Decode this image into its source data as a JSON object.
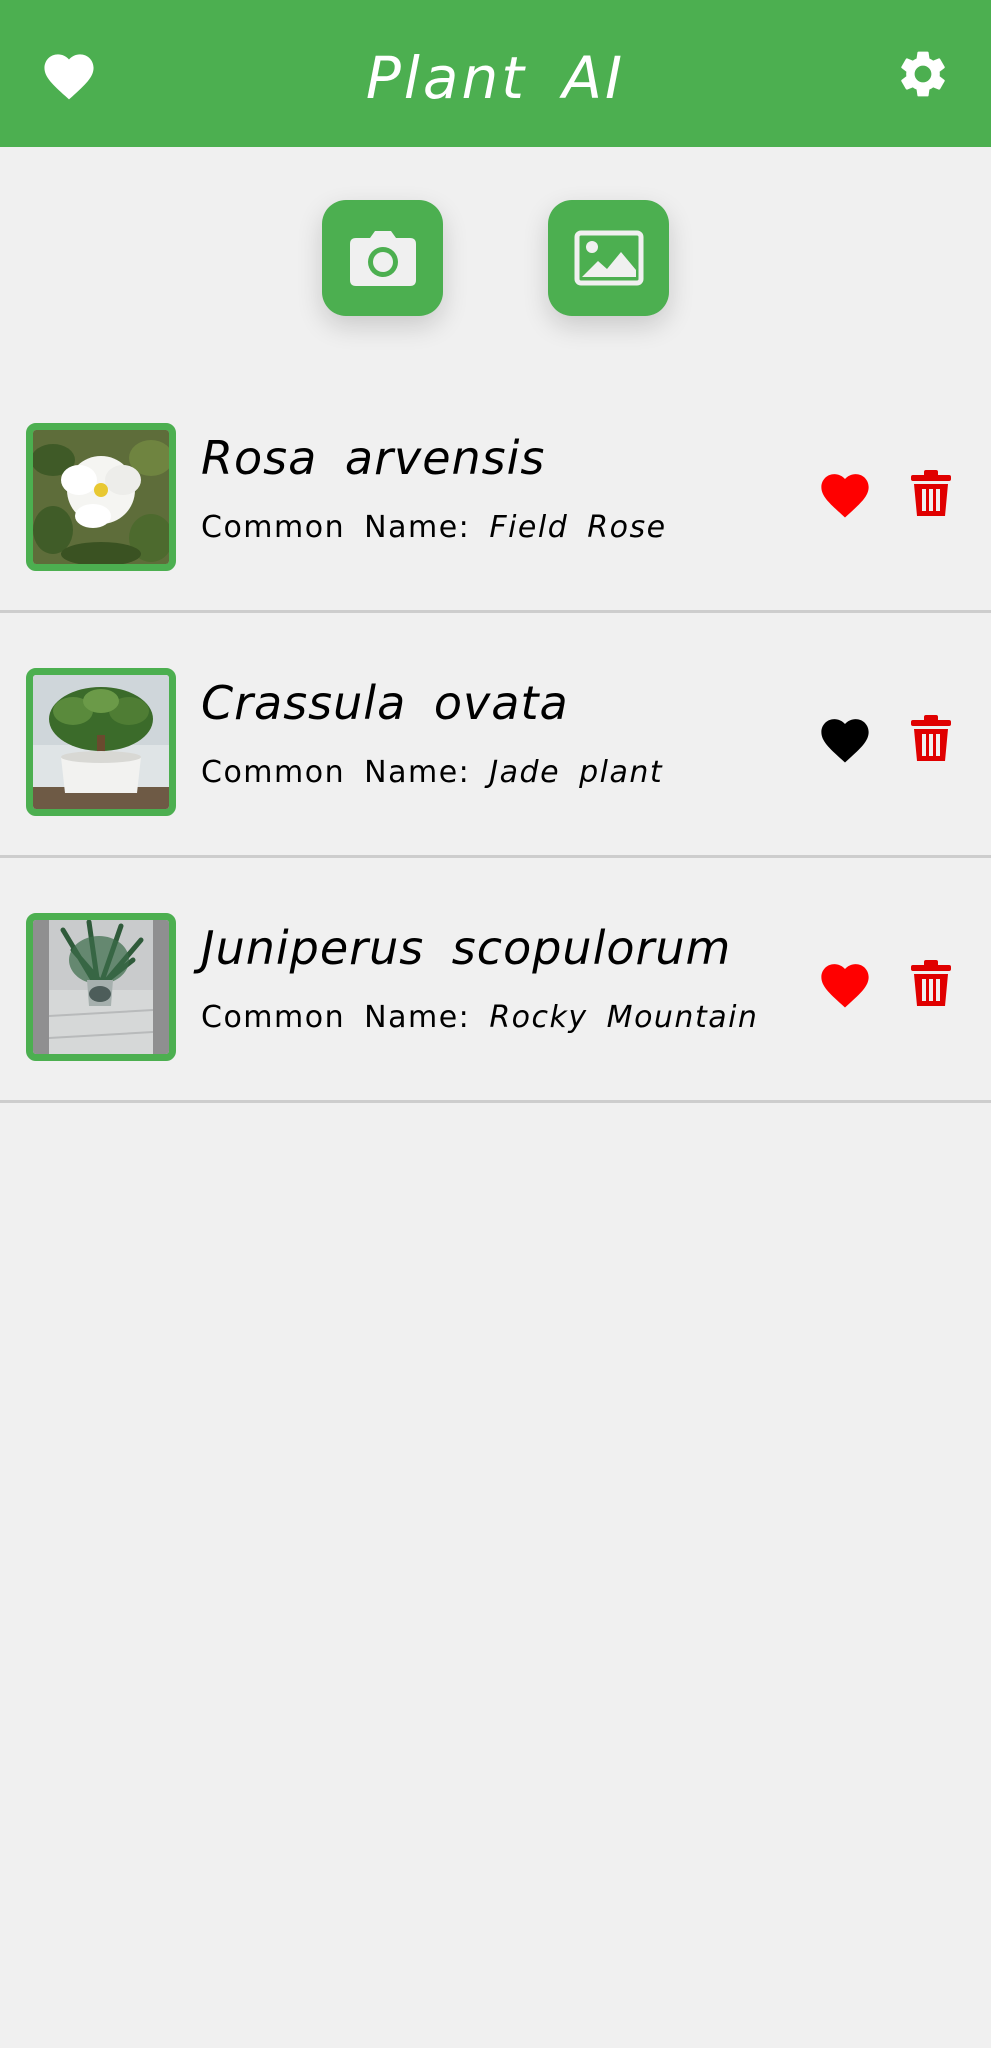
{
  "app": {
    "title": "Plant AI",
    "accent_color": "#4caf50",
    "favorite_color": "#ff0000",
    "unfavorite_color": "#000000",
    "delete_color": "#e00000"
  },
  "appbar": {
    "left_icon": "heart-icon",
    "right_icon": "gear-icon"
  },
  "actions": {
    "camera_icon": "camera-icon",
    "gallery_icon": "image-icon"
  },
  "plants": [
    {
      "scientific_name": "Rosa arvensis",
      "common_label": "Common Name:",
      "common_name": "Field Rose",
      "favorited": true,
      "thumbnail": "white-rose-photo"
    },
    {
      "scientific_name": "Crassula ovata",
      "common_label": "Common Name:",
      "common_name": "Jade plant",
      "favorited": false,
      "thumbnail": "jade-plant-photo"
    },
    {
      "scientific_name": "Juniperus scopulorum",
      "common_label": "Common Name:",
      "common_name": "Rocky Mountain",
      "favorited": true,
      "thumbnail": "juniper-photo"
    }
  ]
}
